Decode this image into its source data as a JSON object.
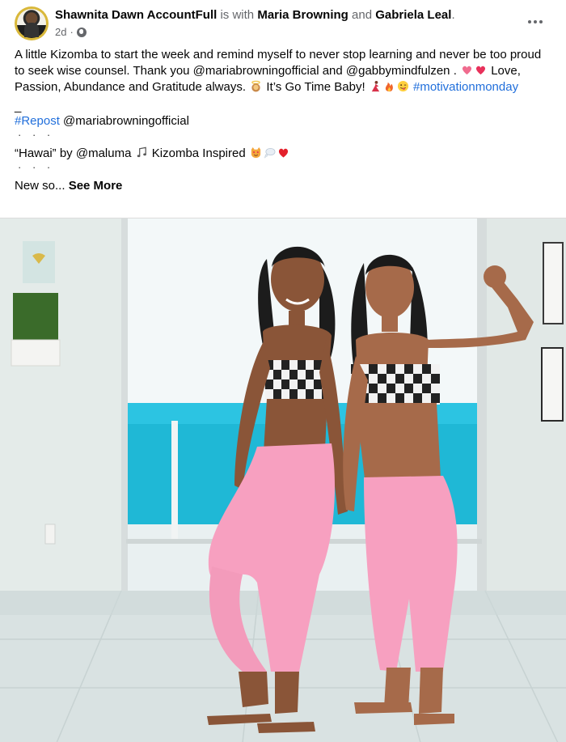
{
  "post": {
    "author": "Shawnita Dawn AccountFull",
    "with_text": "is with",
    "tag1": "Maria Browning",
    "and_text": "and",
    "tag2": "Gabriela Leal",
    "period": ".",
    "time": "2d",
    "sep": "·",
    "privacy_icon": "globe-icon",
    "more_icon": "more-options-icon"
  },
  "body": {
    "p1_text1": "A little Kizomba to start the week and remind myself to never stop learning and never be too proud to seek wise counsel.  Thank you @mariabrowningofficial and @gabbymindfulzen .",
    "p1_text2": "Love, Passion, Abundance and Gratitude always.",
    "p1_text3": "It’s Go Time Baby!",
    "hashtag_motivation": "#motivationmonday",
    "underscore": "_",
    "hashtag_repost": "#Repost",
    "repost_user": "@mariabrowningofficial",
    "dots1": "· · ·",
    "song_line": "“Hawai” by @maluma",
    "song_rest": "Kizomba Inspired",
    "dots2": "· · ·",
    "truncated": "New so...",
    "see_more": "See More"
  },
  "colors": {
    "link": "#216fdb",
    "secondary": "#65676b",
    "pink_leggings": "#f7a0c0",
    "ocean": "#1fb8d6"
  }
}
